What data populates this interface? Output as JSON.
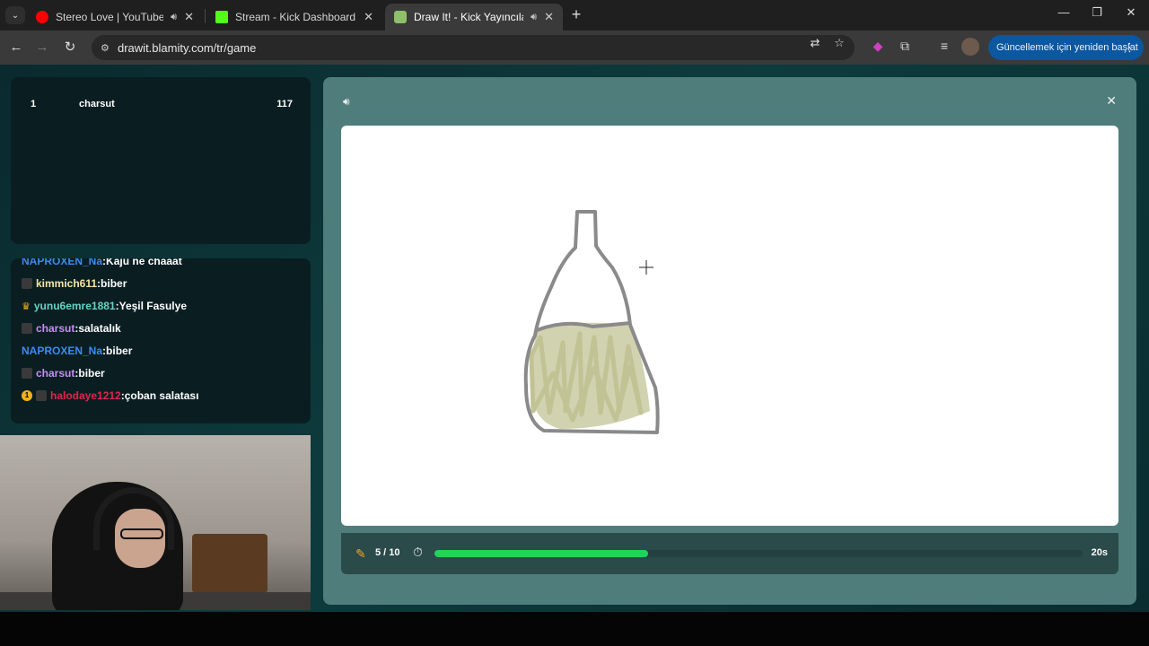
{
  "browser": {
    "tabs": [
      {
        "title": "Stereo Love | YouTube Music",
        "favicon_color": "#ff0000",
        "audio": true
      },
      {
        "title": "Stream - Kick Dashboard",
        "favicon_color": "#53fc18",
        "audio": false
      },
      {
        "title": "Draw It! - Kick Yayıncıları İçin",
        "favicon_color": "#8fbf6a",
        "audio": true
      }
    ],
    "url": "drawit.blamity.com/tr/game",
    "restart_label": "Güncellemek için yeniden başlat"
  },
  "leaderboard": [
    {
      "rank": "1",
      "name": "charsut",
      "score": "117"
    }
  ],
  "chat": [
    {
      "user": "NAPROXEN_Na",
      "text": "Kaju ne chaaat",
      "color": "#3b8cf0",
      "badge": "none"
    },
    {
      "user": "kimmich611",
      "text": "biber",
      "color": "#f3e6a1",
      "badge": "square"
    },
    {
      "user": "yunu6emre1881",
      "text": "Yeşil Fasulye",
      "color": "#63d4c4",
      "badge": "crown"
    },
    {
      "user": "charsut",
      "text": "salatalık",
      "color": "#c78ef0",
      "badge": "square"
    },
    {
      "user": "NAPROXEN_Na",
      "text": "biber",
      "color": "#3b8cf0",
      "badge": "none"
    },
    {
      "user": "charsut",
      "text": "biber",
      "color": "#c78ef0",
      "badge": "square"
    },
    {
      "user": "halodaye1212",
      "text": "çoban salatası",
      "color": "#e0264a",
      "badge": "coin+square"
    }
  ],
  "game": {
    "round": "5 / 10",
    "time_left": "20s",
    "progress_fraction": 0.33
  },
  "colors": {
    "accent": "#1fd35c",
    "pencil": "#f6a623",
    "drawing_outline": "#8a8a8a",
    "drawing_fill": "#c1c394"
  }
}
